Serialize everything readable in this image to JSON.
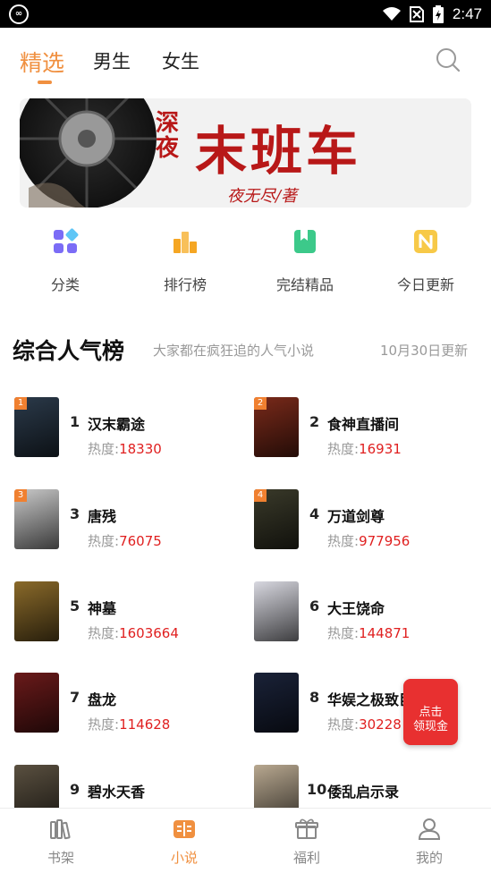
{
  "status": {
    "time": "2:47",
    "logo": "∞"
  },
  "tabs": [
    {
      "label": "精选",
      "active": true
    },
    {
      "label": "男生",
      "active": false
    },
    {
      "label": "女生",
      "active": false
    }
  ],
  "banner": {
    "title": "末班车",
    "prefix": "深夜",
    "author": "夜无尽/著"
  },
  "quick": [
    {
      "label": "分类",
      "icon": "category-icon",
      "color": "#7b6cf6"
    },
    {
      "label": "排行榜",
      "icon": "ranking-icon",
      "color": "#f5a623"
    },
    {
      "label": "完结精品",
      "icon": "finished-book-icon",
      "color": "#3cc98a"
    },
    {
      "label": "今日更新",
      "icon": "new-update-icon",
      "color": "#f7c948"
    }
  ],
  "section": {
    "title": "综合人气榜",
    "subtitle": "大家都在疯狂追的人气小说",
    "date": "10月30日更新"
  },
  "heat_label": "热度:",
  "books": [
    {
      "rank": "1",
      "name": "汉末霸途",
      "heat": "18330",
      "badge": "1",
      "cover": "#2b3a4a"
    },
    {
      "rank": "2",
      "name": "食神直播间",
      "heat": "16931",
      "badge": "2",
      "cover": "#7a2a1a"
    },
    {
      "rank": "3",
      "name": "唐残",
      "heat": "76075",
      "badge": "3",
      "cover": "#c9c9c9"
    },
    {
      "rank": "4",
      "name": "万道剑尊",
      "heat": "977956",
      "badge": "4",
      "cover": "#3a3a2a"
    },
    {
      "rank": "5",
      "name": "神墓",
      "heat": "1603664",
      "badge": "",
      "cover": "#8a6a2a"
    },
    {
      "rank": "6",
      "name": "大王饶命",
      "heat": "144871",
      "badge": "",
      "cover": "#d8d8e0"
    },
    {
      "rank": "7",
      "name": "盘龙",
      "heat": "114628",
      "badge": "",
      "cover": "#6a1a1a"
    },
    {
      "rank": "8",
      "name": "华娱之极致巨星",
      "heat": "30228",
      "badge": "",
      "cover": "#1a2238"
    },
    {
      "rank": "9",
      "name": "碧水天香",
      "heat": "",
      "badge": "",
      "cover": "#5a5040"
    },
    {
      "rank": "10",
      "name": "倭乱启示录",
      "heat": "",
      "badge": "",
      "cover": "#b8a890"
    }
  ],
  "redpack": {
    "line1": "点击",
    "line2": "领现金"
  },
  "bottom_nav": [
    {
      "label": "书架",
      "active": false
    },
    {
      "label": "小说",
      "active": true
    },
    {
      "label": "福利",
      "active": false
    },
    {
      "label": "我的",
      "active": false
    }
  ]
}
